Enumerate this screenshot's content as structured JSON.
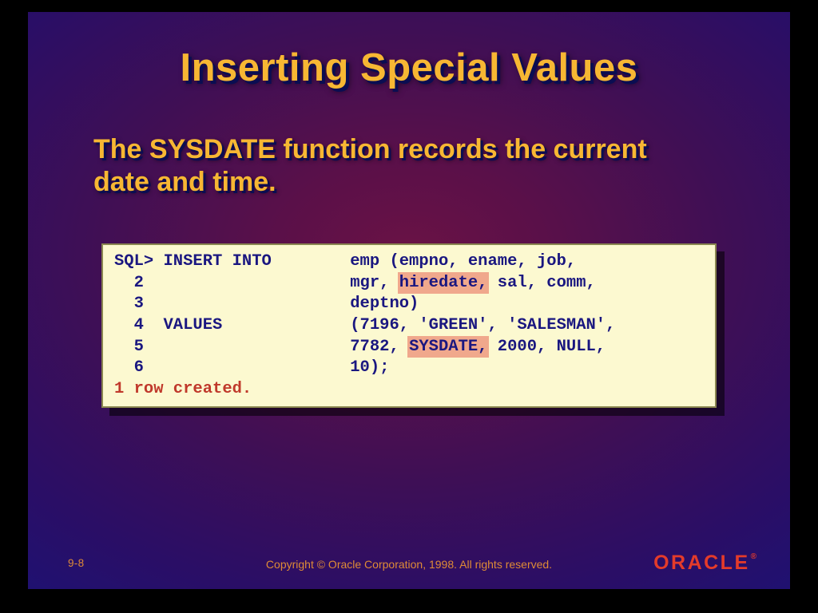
{
  "title": "Inserting Special Values",
  "subtitle": "The SYSDATE function records the current date and time.",
  "code": {
    "l1a": "SQL> INSERT INTO\temp (empno, ename, job, ",
    "l2a": "  2              \tmgr, ",
    "l2_hl": "hiredate,",
    "l2b": " sal, comm, ",
    "l3": "  3              \tdeptno)",
    "l4": "  4  VALUES      \t(7196, 'GREEN', 'SALESMAN',",
    "l5a": "  5              \t7782, ",
    "l5_hl": "SYSDATE,",
    "l5b": " 2000, NULL,",
    "l6": "  6              \t10);",
    "result": "1 row created."
  },
  "footer": {
    "page": "9-8",
    "copyright": "Copyright © Oracle Corporation, 1998. All rights reserved.",
    "logo": "ORACLE"
  }
}
